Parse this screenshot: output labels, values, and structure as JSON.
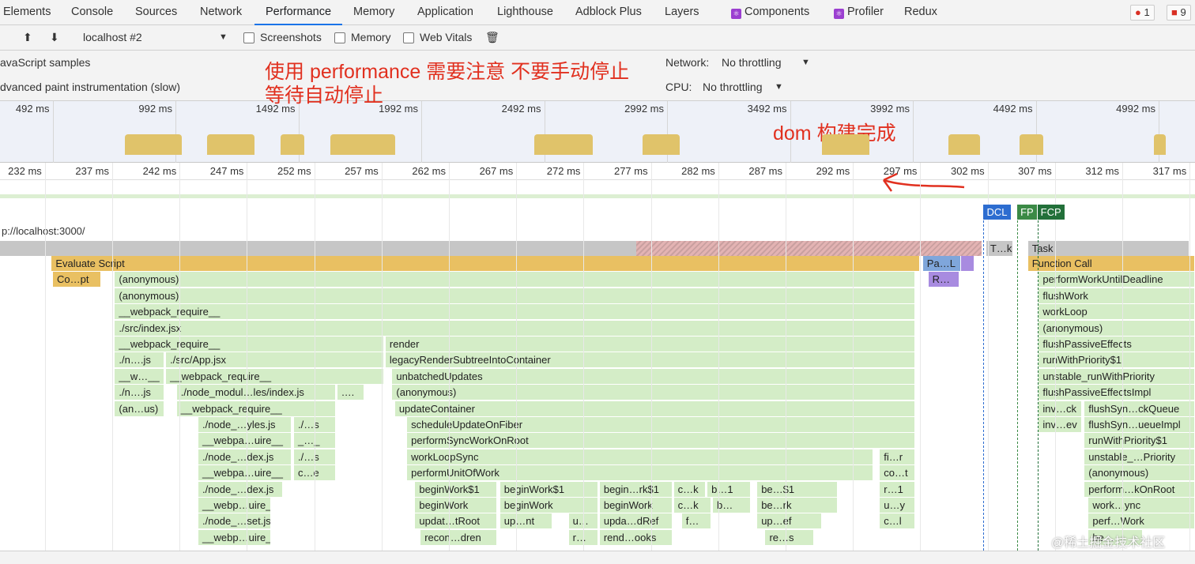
{
  "tabs": [
    "Elements",
    "Console",
    "Sources",
    "Network",
    "Performance",
    "Memory",
    "Application",
    "Lighthouse",
    "Adblock Plus",
    "Layers",
    "Components",
    "Profiler",
    "Redux"
  ],
  "active_tab": "Performance",
  "badges": {
    "errors": "1",
    "issues": "9"
  },
  "toolbar": {
    "profile_select": "localhost #2",
    "screenshots": "Screenshots",
    "memory": "Memory",
    "web_vitals": "Web Vitals"
  },
  "settings": {
    "js_samples": "avaScript samples",
    "paint": "dvanced paint instrumentation (slow)",
    "network_label": "Network:",
    "network_value": "No throttling",
    "cpu_label": "CPU:",
    "cpu_value": "No throttling"
  },
  "overview": {
    "ticks": [
      "492 ms",
      "992 ms",
      "1492 ms",
      "1992 ms",
      "2492 ms",
      "2992 ms",
      "3492 ms",
      "3992 ms",
      "4492 ms",
      "4992 ms"
    ],
    "cpu_ms": [
      [
        786,
        1018
      ],
      [
        1121,
        1314
      ],
      [
        1420,
        1516
      ],
      [
        1622,
        1886
      ],
      [
        2452,
        2690
      ],
      [
        2892,
        3043
      ],
      [
        3622,
        3815
      ],
      [
        4136,
        4265
      ],
      [
        4426,
        4522
      ],
      [
        4972,
        5020
      ]
    ]
  },
  "ruler": {
    "ticks_ms": [
      232,
      237,
      242,
      247,
      252,
      257,
      262,
      267,
      272,
      277,
      282,
      287,
      292,
      297,
      302,
      307,
      312,
      317
    ],
    "unit": "ms"
  },
  "markers": [
    {
      "label": "DCL",
      "ms": 301.7,
      "color": "#2d6dd0"
    },
    {
      "label": "FP",
      "ms": 304.2,
      "color": "#3b8a46"
    },
    {
      "label": "FCP",
      "ms": 305.7,
      "color": "#23703a"
    }
  ],
  "main_thread_url": "p://localhost:3000/",
  "flame": [
    [
      "",
      226,
      301.6,
      -1,
      "gr"
    ],
    [
      "T…k",
      301.9,
      303.9,
      -1,
      "gr"
    ],
    [
      "Task",
      305,
      317,
      -1,
      "gr"
    ],
    [
      "Evaluate Script",
      232.5,
      297,
      0,
      "y"
    ],
    [
      "Pa…L",
      297.2,
      300,
      0,
      "b"
    ],
    [
      "",
      300,
      301,
      0,
      "p"
    ],
    [
      "Function Call",
      305,
      317.4,
      0,
      "y"
    ],
    [
      "Co…pt",
      232.6,
      236.2,
      1,
      "y"
    ],
    [
      "(anonymous)",
      237.2,
      296.6,
      1,
      "g"
    ],
    [
      "R…",
      297.6,
      299.9,
      1,
      "p"
    ],
    [
      "performWorkUntilDeadline",
      305.8,
      317.4,
      1,
      "g"
    ],
    [
      "(anonymous)",
      237.2,
      296.6,
      2,
      "g"
    ],
    [
      "flushWork",
      305.8,
      317.4,
      2,
      "g"
    ],
    [
      "__webpack_require__",
      237.2,
      296.6,
      3,
      "g"
    ],
    [
      "workLoop",
      305.8,
      317.4,
      3,
      "g"
    ],
    [
      "./src/index.jsx",
      237.2,
      296.6,
      4,
      "g"
    ],
    [
      "(anonymous)",
      305.8,
      317.4,
      4,
      "g"
    ],
    [
      "__webpack_require__",
      237.2,
      257.2,
      5,
      "g"
    ],
    [
      "render",
      257.3,
      296.6,
      5,
      "g"
    ],
    [
      "flushPassiveEffects",
      305.8,
      317.4,
      5,
      "g"
    ],
    [
      "./n….js",
      237.2,
      240.9,
      6,
      "g"
    ],
    [
      "./src/App.jsx",
      241,
      257.2,
      6,
      "g"
    ],
    [
      "legacyRenderSubtreeIntoContainer",
      257.3,
      296.6,
      6,
      "g"
    ],
    [
      "runWithPriority$1",
      305.8,
      317.4,
      6,
      "g"
    ],
    [
      "__w…__",
      237.2,
      240.9,
      7,
      "g"
    ],
    [
      "__webpack_require__",
      241,
      257.2,
      7,
      "g"
    ],
    [
      "unbatchedUpdates",
      257.8,
      296.6,
      7,
      "g"
    ],
    [
      "unstable_runWithPriority",
      305.8,
      317.4,
      7,
      "g"
    ],
    [
      "./n….js",
      237.2,
      240.9,
      8,
      "g"
    ],
    [
      "./node_modul…les/index.js",
      241.8,
      253.6,
      8,
      "g"
    ],
    [
      "….",
      253.7,
      255.7,
      8,
      "g"
    ],
    [
      "(anonymous)",
      257.8,
      296.6,
      8,
      "g"
    ],
    [
      "flushPassiveEffectsImpl",
      305.8,
      317.4,
      8,
      "g"
    ],
    [
      "(an…us)",
      237.2,
      240.9,
      9,
      "g"
    ],
    [
      "__webpack_require__",
      241.8,
      253.6,
      9,
      "g"
    ],
    [
      "updateContainer",
      258,
      296.6,
      9,
      "g"
    ],
    [
      "inv…ck",
      305.8,
      309,
      9,
      "g"
    ],
    [
      "flushSyn…ckQueue",
      309.2,
      317.4,
      9,
      "g"
    ],
    [
      "./node_…yles.js",
      243.4,
      250.3,
      10,
      "g"
    ],
    [
      "./…s",
      250.5,
      253.6,
      10,
      "g"
    ],
    [
      "scheduleUpdateOnFiber",
      258.9,
      296.6,
      10,
      "g"
    ],
    [
      "inv…ev",
      305.8,
      309,
      10,
      "g"
    ],
    [
      "flushSyn…ueueImpl",
      309.2,
      317.4,
      10,
      "g"
    ],
    [
      "__webpa…uire__",
      243.4,
      250.3,
      11,
      "g"
    ],
    [
      "_…_",
      250.5,
      253.6,
      11,
      "g"
    ],
    [
      "performSyncWorkOnRoot",
      258.9,
      296.6,
      11,
      "g"
    ],
    [
      "runWithPriority$1",
      309.2,
      317.4,
      11,
      "g"
    ],
    [
      "./node_…dex.js",
      243.4,
      250.3,
      12,
      "g"
    ],
    [
      "./…s",
      250.5,
      253.6,
      12,
      "g"
    ],
    [
      "workLoopSync",
      258.9,
      293.5,
      12,
      "g"
    ],
    [
      "fi…r",
      294,
      296.6,
      12,
      "g"
    ],
    [
      "unstable_…Priority",
      309.2,
      317.4,
      12,
      "g"
    ],
    [
      "__webpa…uire__",
      243.4,
      250.3,
      13,
      "g"
    ],
    [
      "c…e",
      250.5,
      253.6,
      13,
      "g"
    ],
    [
      "performUnitOfWork",
      258.9,
      293.5,
      13,
      "g"
    ],
    [
      "co…t",
      294,
      296.6,
      13,
      "g"
    ],
    [
      "(anonymous)",
      309.2,
      317.4,
      13,
      "g"
    ],
    [
      "./node_…dex.js",
      243.4,
      249.7,
      14,
      "g"
    ],
    [
      "beginWork$1",
      259.5,
      265.6,
      14,
      "g"
    ],
    [
      "beginWork$1",
      265.8,
      273.1,
      14,
      "g"
    ],
    [
      "begin…rk$1",
      273.2,
      278.6,
      14,
      "g"
    ],
    [
      "c…k",
      278.7,
      281.1,
      14,
      "g"
    ],
    [
      "b…1",
      281.2,
      284.4,
      14,
      "g"
    ],
    [
      "be…$1",
      284.9,
      290.9,
      14,
      "g"
    ],
    [
      "r…1",
      294,
      296.6,
      14,
      "g"
    ],
    [
      "perform…kOnRoot",
      309.2,
      317.4,
      14,
      "g"
    ],
    [
      "__webp…uire__",
      243.4,
      248.8,
      15,
      "g"
    ],
    [
      "beginWork",
      259.5,
      265.6,
      15,
      "g"
    ],
    [
      "beginWork",
      265.8,
      273.1,
      15,
      "g"
    ],
    [
      "beginWork",
      273.2,
      278.6,
      15,
      "g"
    ],
    [
      "c…k",
      278.7,
      281.5,
      15,
      "g"
    ],
    [
      "b…",
      281.6,
      284.4,
      15,
      "g"
    ],
    [
      "be…rk",
      284.9,
      290.9,
      15,
      "g"
    ],
    [
      "u…y",
      294,
      296.6,
      15,
      "g"
    ],
    [
      "work…ync",
      309.5,
      317.4,
      15,
      "g"
    ],
    [
      "./node_…set.js",
      243.4,
      248.8,
      16,
      "g"
    ],
    [
      "updat…tRoot",
      259.5,
      265.6,
      16,
      "g"
    ],
    [
      "up…nt",
      265.8,
      269.7,
      16,
      "g"
    ],
    [
      "u…",
      270.9,
      273.1,
      16,
      "g"
    ],
    [
      "upda…dRef",
      273.2,
      278.6,
      16,
      "g"
    ],
    [
      "f…",
      279.3,
      281.5,
      16,
      "g"
    ],
    [
      "up…ef",
      284.9,
      289.7,
      16,
      "g"
    ],
    [
      "c…l",
      294,
      296.6,
      16,
      "g"
    ],
    [
      "perf…Work",
      309.5,
      317.4,
      16,
      "g"
    ],
    [
      "__webp…uire__",
      243.4,
      248.8,
      17,
      "g"
    ],
    [
      "recon…dren",
      259.9,
      265.6,
      17,
      "g"
    ],
    [
      "r…",
      270.9,
      273.1,
      17,
      "g"
    ],
    [
      "rend…ooks",
      273.2,
      278.6,
      17,
      "g"
    ],
    [
      "re…s",
      285.5,
      289.1,
      17,
      "g"
    ],
    [
      "be…",
      309.5,
      313.5,
      17,
      "g"
    ]
  ],
  "annotations": {
    "line1": "使用 performance 需要注意 不要手动停止",
    "line2": "等待自动停止",
    "dom": "dom 构建完成"
  },
  "watermark": "@稀土掘金技术社区"
}
